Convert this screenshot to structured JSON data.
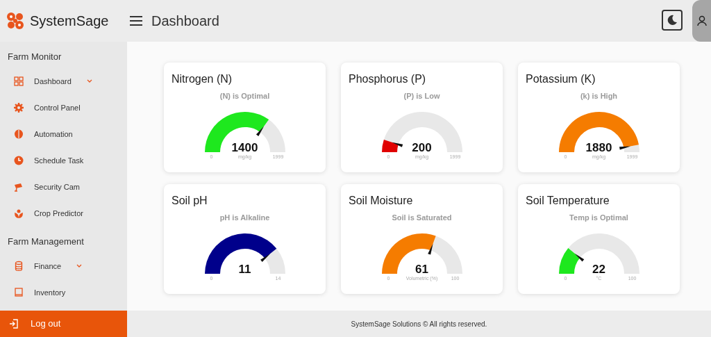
{
  "brand": "SystemSage",
  "page_title": "Dashboard",
  "sidebar": {
    "sections": [
      {
        "title": "Farm Monitor",
        "items": [
          {
            "label": "Dashboard",
            "expandable": true
          },
          {
            "label": "Control Panel",
            "expandable": false
          },
          {
            "label": "Automation",
            "expandable": false
          },
          {
            "label": "Schedule Task",
            "expandable": false
          },
          {
            "label": "Security Cam",
            "expandable": false
          },
          {
            "label": "Crop Predictor",
            "expandable": false
          }
        ]
      },
      {
        "title": "Farm Management",
        "items": [
          {
            "label": "Finance",
            "expandable": true
          },
          {
            "label": "Inventory",
            "expandable": false
          }
        ]
      }
    ],
    "logout": "Log out"
  },
  "gauges": [
    {
      "title": "Nitrogen (N)",
      "status": "(N) is Optimal",
      "value": "1400",
      "unit": "mg/kg",
      "min": "0",
      "max": "1999",
      "color": "#1ee81e"
    },
    {
      "title": "Phosphorus (P)",
      "status": "(P) is Low",
      "value": "200",
      "unit": "mg/kg",
      "min": "0",
      "max": "1999",
      "color": "#e00000"
    },
    {
      "title": "Potassium (K)",
      "status": "(k) is High",
      "value": "1880",
      "unit": "mg/kg",
      "min": "0",
      "max": "1999",
      "color": "#f57c00"
    },
    {
      "title": "Soil pH",
      "status": "pH is Alkaline",
      "value": "11",
      "min": "0",
      "max": "14",
      "color": "#00008b"
    },
    {
      "title": "Soil Moisture",
      "status": "Soil is Saturated",
      "value": "61",
      "unit": "Volumetric (%)",
      "min": "0",
      "max": "100",
      "color": "#f57c00"
    },
    {
      "title": "Soil Temperature",
      "status": "Temp is Optimal",
      "value": "22",
      "unit": "°C",
      "min": "0",
      "max": "100",
      "color": "#1ee81e"
    }
  ],
  "footer": "SystemSage Solutions © All rights reserved."
}
